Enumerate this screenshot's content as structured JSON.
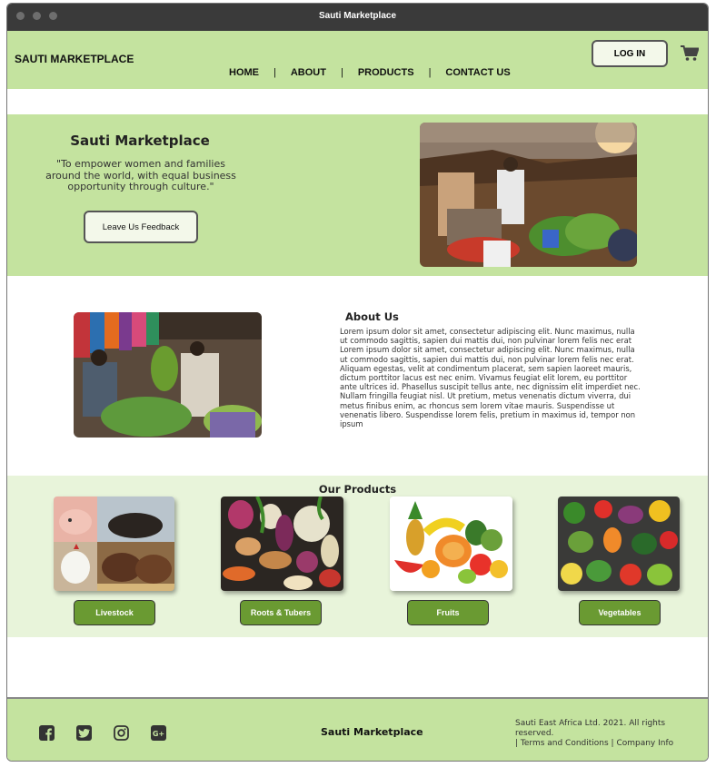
{
  "window": {
    "title": "Sauti Marketplace"
  },
  "header": {
    "brand": "SAUTI MARKETPLACE",
    "nav": [
      "HOME",
      "ABOUT",
      "PRODUCTS",
      "CONTACT US"
    ],
    "nav_separator": "|",
    "login_label": "LOG IN",
    "cart_icon": "cart-icon"
  },
  "hero": {
    "title": "Sauti Marketplace",
    "quote": "\"To empower women and families around the world, with equal business opportunity through culture.\"",
    "feedback_label": "Leave Us Feedback"
  },
  "about": {
    "title": "About Us",
    "body": "Lorem ipsum dolor sit amet, consectetur adipiscing elit. Nunc maximus, nulla ut commodo sagittis, sapien dui mattis dui, non pulvinar lorem felis nec erat Lorem ipsum dolor sit amet, consectetur adipiscing elit. Nunc maximus, nulla ut commodo sagittis, sapien dui mattis dui, non pulvinar lorem felis nec erat. Aliquam egestas, velit at condimentum placerat, sem sapien laoreet mauris, dictum porttitor lacus est nec enim. Vivamus feugiat elit lorem, eu porttitor ante ultrices id. Phasellus suscipit tellus ante, nec dignissim elit imperdiet nec. Nullam fringilla feugiat nisl. Ut pretium, metus venenatis dictum viverra, dui metus finibus enim, ac rhoncus sem lorem vitae mauris. Suspendisse ut venenatis libero. Suspendisse lorem felis, pretium in maximus id, tempor non ipsum"
  },
  "products": {
    "title": "Our Products",
    "items": [
      {
        "label": "Livestock"
      },
      {
        "label": "Roots & Tubers"
      },
      {
        "label": "Fruits"
      },
      {
        "label": "Vegetables"
      }
    ]
  },
  "footer": {
    "brand": "Sauti Marketplace",
    "copyright": "Sauti East Africa Ltd. 2021. All rights reserved.",
    "links": "| Terms and Conditions | Company Info",
    "social_icons": [
      "facebook-icon",
      "twitter-icon",
      "instagram-icon",
      "google-plus-icon"
    ]
  },
  "colors": {
    "header_bg": "#c4e39f",
    "products_bg": "#e8f4da",
    "button_green": "#6a9a32",
    "titlebar": "#3a3a3a"
  }
}
